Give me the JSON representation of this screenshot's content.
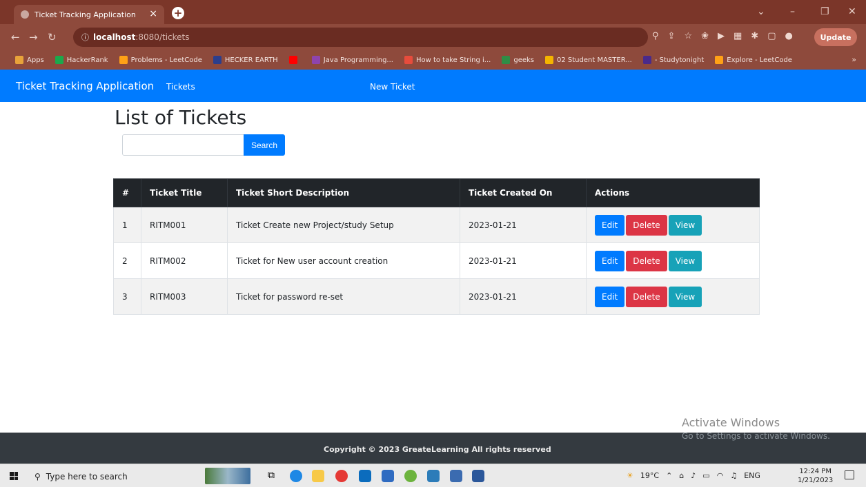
{
  "browser": {
    "tab_title": "Ticket Tracking Application",
    "tab_close": "×",
    "new_tab": "+",
    "url_host": "localhost",
    "url_path": ":8080/tickets",
    "update_label": "Update",
    "bookmarks": [
      {
        "label": "Apps",
        "color": "#e8a33a"
      },
      {
        "label": "HackerRank",
        "color": "#1ba94c"
      },
      {
        "label": "Problems - LeetCode",
        "color": "#ffa116"
      },
      {
        "label": "HECKER EARTH",
        "color": "#2c3e8c"
      },
      {
        "label": "",
        "color": "#ff0000"
      },
      {
        "label": "Java Programming...",
        "color": "#8e44ad"
      },
      {
        "label": "How to take String i...",
        "color": "#e74c3c"
      },
      {
        "label": "geeks",
        "color": "#2f8d46"
      },
      {
        "label": "02 Student MASTER...",
        "color": "#f4b400"
      },
      {
        "label": "- Studytonight",
        "color": "#4a2a8a"
      },
      {
        "label": "Explore - LeetCode",
        "color": "#ffa116"
      }
    ],
    "bookmarks_more": "»"
  },
  "app_nav": {
    "brand": "Ticket Tracking Application",
    "tickets_link": "Tickets",
    "new_ticket_link": "New Ticket"
  },
  "page": {
    "title": "List of Tickets",
    "search_placeholder": "",
    "search_button": "Search"
  },
  "table": {
    "headers": [
      "#",
      "Ticket Title",
      "Ticket Short Description",
      "Ticket Created On",
      "Actions"
    ],
    "rows": [
      {
        "num": "1",
        "title": "RITM001",
        "desc": "Ticket Create new Project/study Setup",
        "created": "2023-01-21"
      },
      {
        "num": "2",
        "title": "RITM002",
        "desc": "Ticket for New user account creation",
        "created": "2023-01-21"
      },
      {
        "num": "3",
        "title": "RITM003",
        "desc": "Ticket for password re-set",
        "created": "2023-01-21"
      }
    ],
    "actions": {
      "edit": "Edit",
      "delete": "Delete",
      "view": "View"
    }
  },
  "footer": {
    "copyright": "Copyright © 2023 GreateLearning All rights reserved"
  },
  "watermark": {
    "line1": "Activate Windows",
    "line2": "Go to Settings to activate Windows."
  },
  "taskbar": {
    "search_text": "Type here to search",
    "weather": "19°C",
    "lang": "ENG",
    "time": "12:24 PM",
    "date": "1/21/2023"
  },
  "colors": {
    "primary": "#007bff",
    "danger": "#dc3545",
    "info": "#17a2b8",
    "dark": "#212529",
    "footer": "#343a40",
    "chrome": "#8e4a3c"
  }
}
